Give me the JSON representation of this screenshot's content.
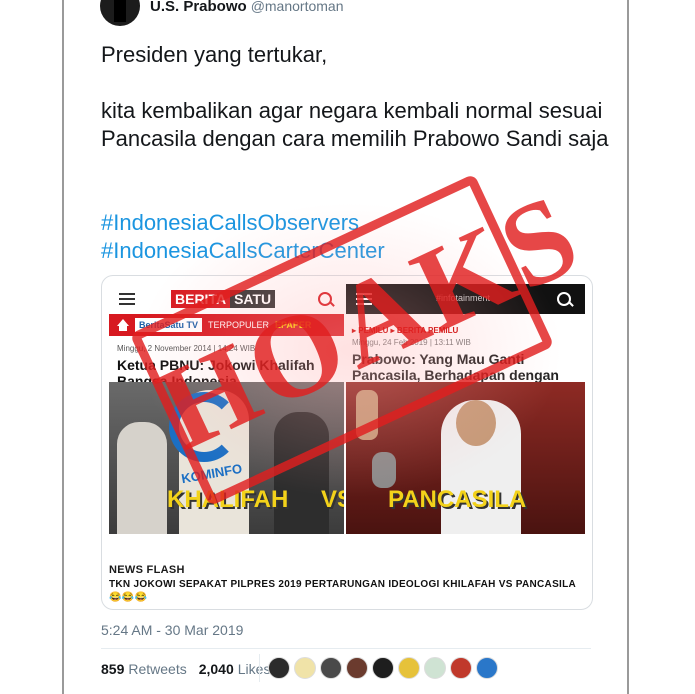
{
  "tweet": {
    "author_name": "U.S. Prabowo",
    "author_handle": "@manortoman",
    "text": "Presiden yang tertukar,\n\nkita kembalikan agar negara kembali normal sesuai Pancasila dengan cara memilih Prabowo Sandi saja",
    "hashtags": [
      "#IndonesiaCallsObservers",
      "#IndonesiaCallsCarterCenter"
    ],
    "timestamp": "5:24 AM - 30 Mar 2019",
    "retweets_count": "859",
    "retweets_label": "Retweets",
    "likes_count": "2,040",
    "likes_label": "Likes"
  },
  "media": {
    "left": {
      "logo_a": "BERITA",
      "logo_b": "SATU",
      "nav_tv": "BeritaSatu TV",
      "nav_top": "TERPOPULER",
      "nav_epaper": "EPAPER",
      "date": "Minggu, 2 November 2014 | 14:24 WIB",
      "title": "Ketua PBNU: Jokowi Khalifah Bangsa Indonesia",
      "kominfo": "KOMINFO",
      "overlay_left": "KHALIFAH",
      "overlay_vs": "VS"
    },
    "right": {
      "brand": "#infotainment",
      "crumb": "▸ PEMILU ▸ BERITA PEMILU",
      "date": "Minggu, 24 Feb 2019 | 13:11 WIB",
      "title": "Prabowo: Yang Mau Ganti Pancasila, Berhadapan dengan Saya",
      "overlay_right": "PANCASILA"
    },
    "newsflash_label": "NEWS FLASH",
    "newsflash_text": "TKN JOKOWI SEPAKAT PILPRES 2019 PERTARUNGAN IDEOLOGI KHILAFAH VS PANCASILA 😂😂😂",
    "stamp_text": "HOAKS",
    "stamp_color": "#e11e1e"
  },
  "liker_colors": [
    "#2b2b2b",
    "#f0e3a8",
    "#4a4a4a",
    "#6b3b2e",
    "#1e1e1e",
    "#e6c23a",
    "#cfe3d3",
    "#c0392b",
    "#2a77c9"
  ]
}
